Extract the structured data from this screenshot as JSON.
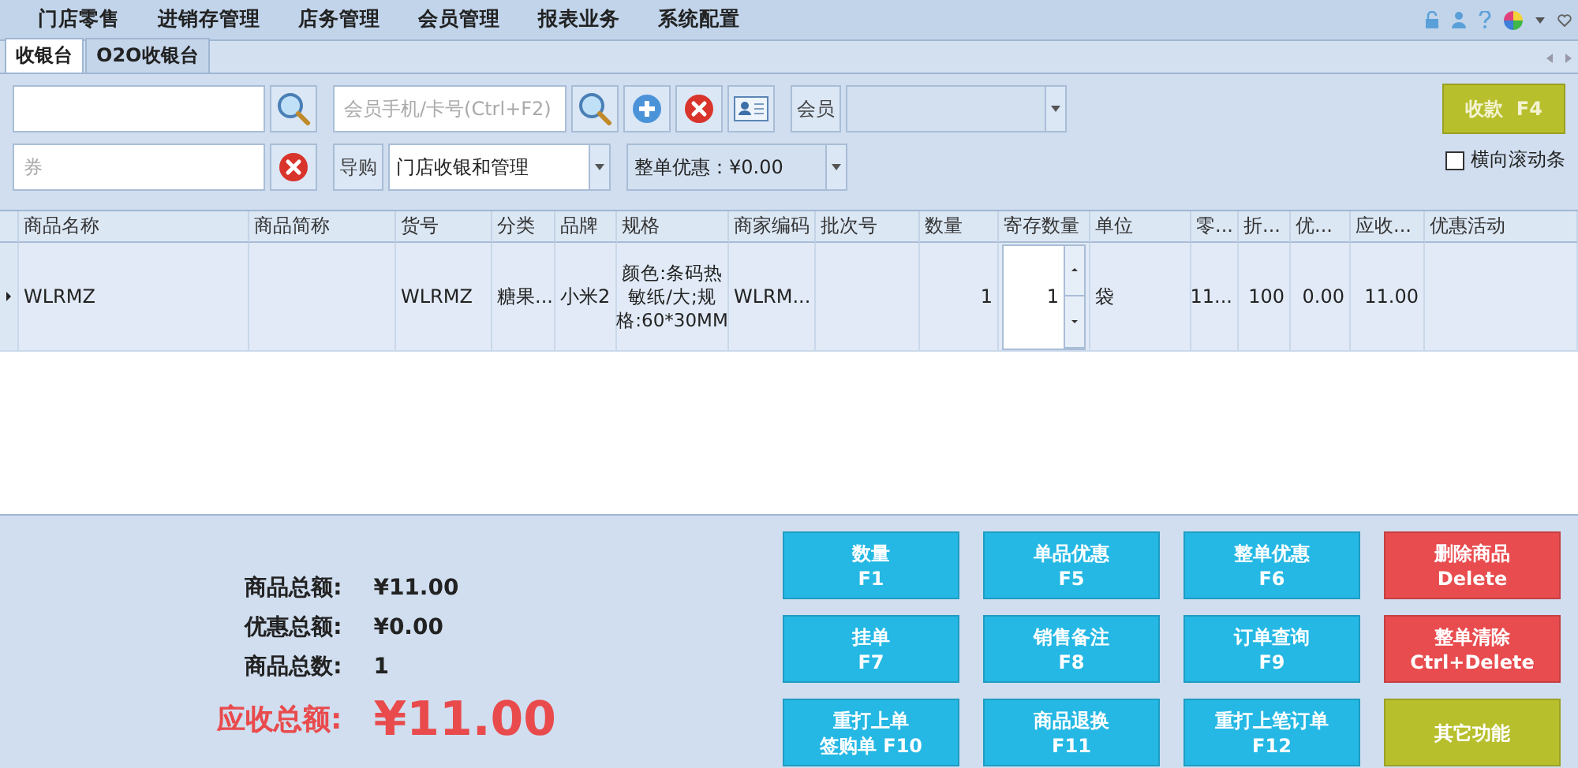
{
  "menu": [
    "门店零售",
    "进销存管理",
    "店务管理",
    "会员管理",
    "报表业务",
    "系统配置"
  ],
  "tabs": [
    {
      "label": "收银台",
      "selected": true
    },
    {
      "label": "O2O收银台",
      "selected": false
    }
  ],
  "toolbar": {
    "member_field": {
      "placeholder": "会员手机/卡号(Ctrl+F2)"
    },
    "member_label": "会员",
    "pay_button": "收款  F4",
    "coupon_field": {
      "placeholder": "券"
    },
    "guide_label": "导购",
    "guide_select": "门店收银和管理",
    "discount_select": "整单优惠：¥0.00",
    "horizontal_scroll": {
      "label": "横向滚动条",
      "checked": false
    }
  },
  "table": {
    "columns": [
      "商品名称",
      "商品简称",
      "货号",
      "分类",
      "品牌",
      "规格",
      "商家编码",
      "批次号",
      "数量",
      "寄存数量",
      "单位",
      "零...",
      "折...",
      "优...",
      "应收...",
      "优惠活动"
    ],
    "rows": [
      {
        "selected": true,
        "cells": [
          "WLRMZ",
          "",
          "WLRMZ",
          "糖果...",
          "小米2",
          "颜色:条码热敏纸/大;规格:60*30MM",
          "WLRM...",
          "",
          "1",
          "1",
          "袋",
          "11...",
          "100",
          "0.00",
          "11.00",
          ""
        ]
      }
    ]
  },
  "summary": [
    {
      "label": "商品总额:",
      "value": "¥11.00",
      "kind": "normal"
    },
    {
      "label": "优惠总额:",
      "value": "¥0.00",
      "kind": "normal"
    },
    {
      "label": "商品总数:",
      "value": "1",
      "kind": "normal"
    },
    {
      "label": "应收总额:",
      "value": "¥11.00",
      "kind": "total"
    }
  ],
  "buttons": [
    {
      "lines": [
        "数量",
        "F1"
      ],
      "color": "#25b8e4"
    },
    {
      "lines": [
        "单品优惠",
        "F5"
      ],
      "color": "#25b8e4"
    },
    {
      "lines": [
        "整单优惠",
        "F6"
      ],
      "color": "#25b8e4"
    },
    {
      "lines": [
        "删除商品",
        "Delete"
      ],
      "color": "#e84c4f"
    },
    {
      "lines": [
        "挂单",
        "F7"
      ],
      "color": "#25b8e4"
    },
    {
      "lines": [
        "销售备注",
        "F8"
      ],
      "color": "#25b8e4"
    },
    {
      "lines": [
        "订单查询",
        "F9"
      ],
      "color": "#25b8e4"
    },
    {
      "lines": [
        "整单清除",
        "Ctrl+Delete"
      ],
      "color": "#e84c4f"
    },
    {
      "lines": [
        "重打上单",
        "签购单 F10"
      ],
      "color": "#25b8e4"
    },
    {
      "lines": [
        "商品退换",
        "F11"
      ],
      "color": "#25b8e4"
    },
    {
      "lines": [
        "重打上笔订单",
        "F12"
      ],
      "color": "#25b8e4"
    },
    {
      "lines": [
        "其它功能"
      ],
      "color": "#b8bf2c"
    }
  ]
}
